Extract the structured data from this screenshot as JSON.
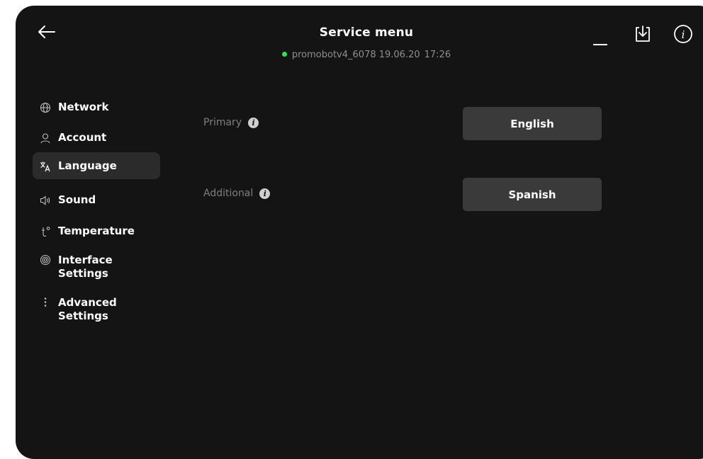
{
  "header": {
    "title": "Service menu",
    "status_text": "promobotv4_6078 19.06.20",
    "status_time": "17:26",
    "status_color": "#2ee54d"
  },
  "toolbar": {
    "back_icon": "arrow-left-icon",
    "minimize_icon": "minimize-icon",
    "download_icon": "download-icon",
    "info_icon": "info-icon"
  },
  "sidebar": {
    "items": [
      {
        "label": "Network",
        "icon": "globe-icon"
      },
      {
        "label": "Account",
        "icon": "user-icon"
      },
      {
        "label": "Language",
        "icon": "translate-icon",
        "active": true
      },
      {
        "label": "Sound",
        "icon": "speaker-icon"
      },
      {
        "label": "Temperature",
        "icon": "thermometer-icon"
      },
      {
        "label": "Interface Settings",
        "icon": "settings-icon"
      },
      {
        "label": "Advanced Settings",
        "icon": "more-vertical-icon"
      }
    ]
  },
  "language": {
    "primary_label": "Primary",
    "primary_value": "English",
    "additional_label": "Additional",
    "additional_value": "Spanish",
    "info_glyph": "i"
  },
  "colors": {
    "background": "#141414",
    "button": "#3a3a3a",
    "active_item": "#2b2b2b",
    "muted_text": "#7f7f7f"
  }
}
